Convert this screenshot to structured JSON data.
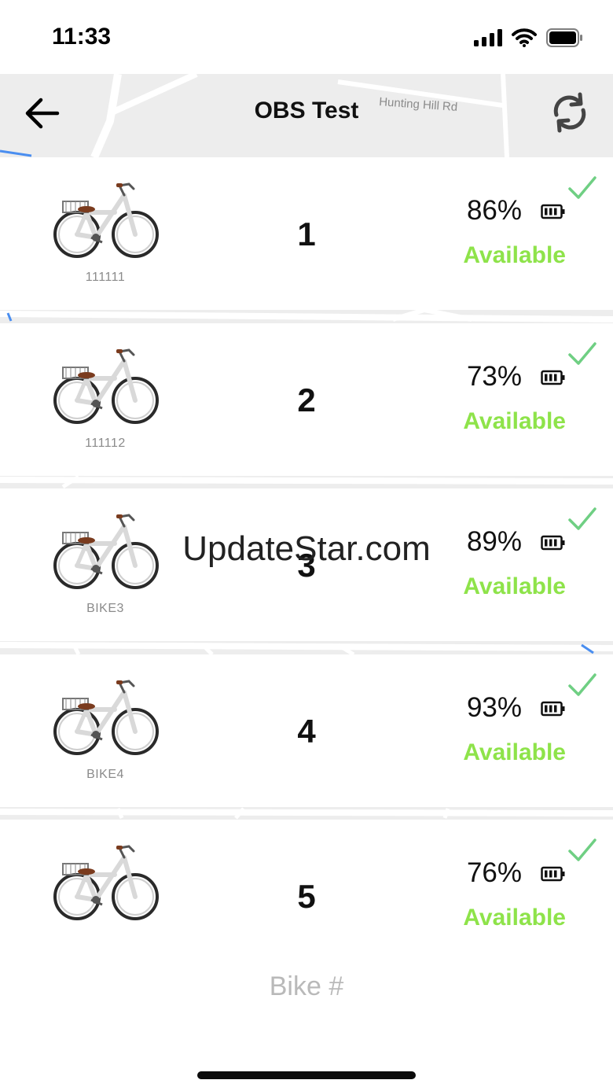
{
  "status_bar": {
    "time": "11:33",
    "icons": [
      "signal-icon",
      "wifi-icon",
      "battery-icon"
    ]
  },
  "header": {
    "title": "OBS Test",
    "back_icon": "back-arrow-icon",
    "refresh_icon": "refresh-icon"
  },
  "map": {
    "labels": [
      "Hunting Hill Rd"
    ]
  },
  "bikes": [
    {
      "serial": "111111",
      "number": "1",
      "battery": "86%",
      "status": "Available"
    },
    {
      "serial": "111112",
      "number": "2",
      "battery": "73%",
      "status": "Available"
    },
    {
      "serial": "BIKE3",
      "number": "3",
      "battery": "89%",
      "status": "Available"
    },
    {
      "serial": "BIKE4",
      "number": "4",
      "battery": "93%",
      "status": "Available"
    },
    {
      "serial": "",
      "number": "5",
      "battery": "76%",
      "status": "Available"
    }
  ],
  "watermark": "UpdateStar.com",
  "search": {
    "placeholder": "Bike #",
    "value": ""
  },
  "colors": {
    "available": "#8ee34a",
    "check": "#6fcf83",
    "map_road": "#ffffff",
    "map_water": "#4a8ef0"
  }
}
